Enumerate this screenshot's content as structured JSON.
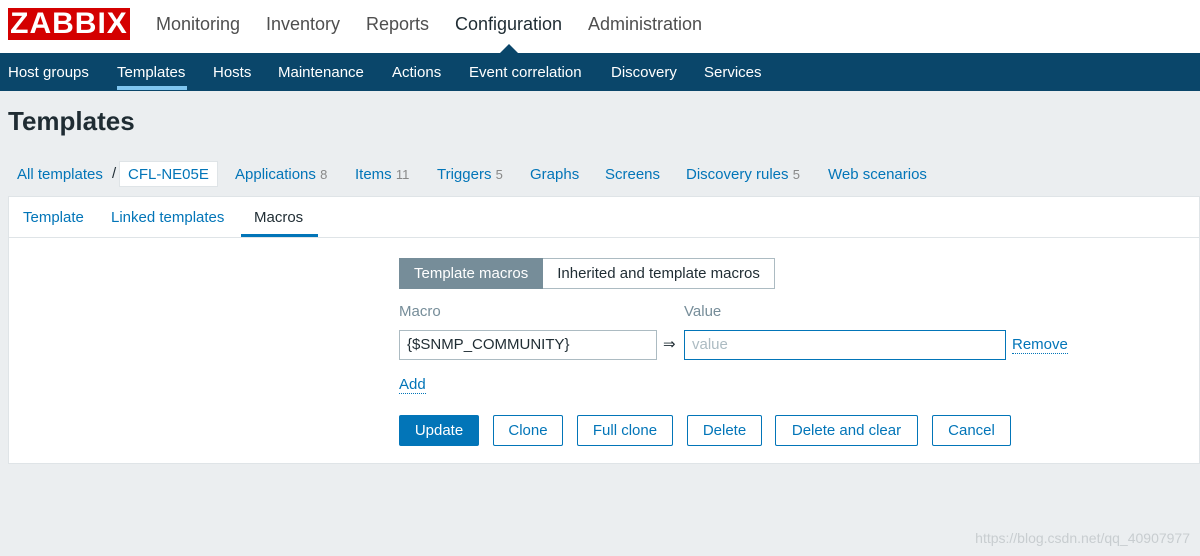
{
  "logo": "ZABBIX",
  "main_menu": [
    "Monitoring",
    "Inventory",
    "Reports",
    "Configuration",
    "Administration"
  ],
  "sub_menu": [
    "Host groups",
    "Templates",
    "Hosts",
    "Maintenance",
    "Actions",
    "Event correlation",
    "Discovery",
    "Services"
  ],
  "page_title": "Templates",
  "template_nav": {
    "all": "All templates",
    "separator": "/",
    "current": "CFL-NE05E",
    "applications": "Applications",
    "applications_count": "8",
    "items": "Items",
    "items_count": "11",
    "triggers": "Triggers",
    "triggers_count": "5",
    "graphs": "Graphs",
    "screens": "Screens",
    "discovery": "Discovery rules",
    "discovery_count": "5",
    "web": "Web scenarios"
  },
  "tabs": [
    "Template",
    "Linked templates",
    "Macros"
  ],
  "macro_mode": {
    "template": "Template macros",
    "inherited": "Inherited and template macros"
  },
  "columns": {
    "macro": "Macro",
    "value": "Value"
  },
  "macro_row": {
    "macro": "{$SNMP_COMMUNITY}",
    "arrow": "⇒",
    "value_placeholder": "value",
    "remove": "Remove"
  },
  "add_label": "Add",
  "buttons": {
    "update": "Update",
    "clone": "Clone",
    "full_clone": "Full clone",
    "delete": "Delete",
    "delete_clear": "Delete and clear",
    "cancel": "Cancel"
  },
  "watermark": "https://blog.csdn.net/qq_40907977",
  "colors": {
    "brand_red": "#d40000",
    "nav_blue": "#0a466a",
    "link_blue": "#0275b8"
  }
}
